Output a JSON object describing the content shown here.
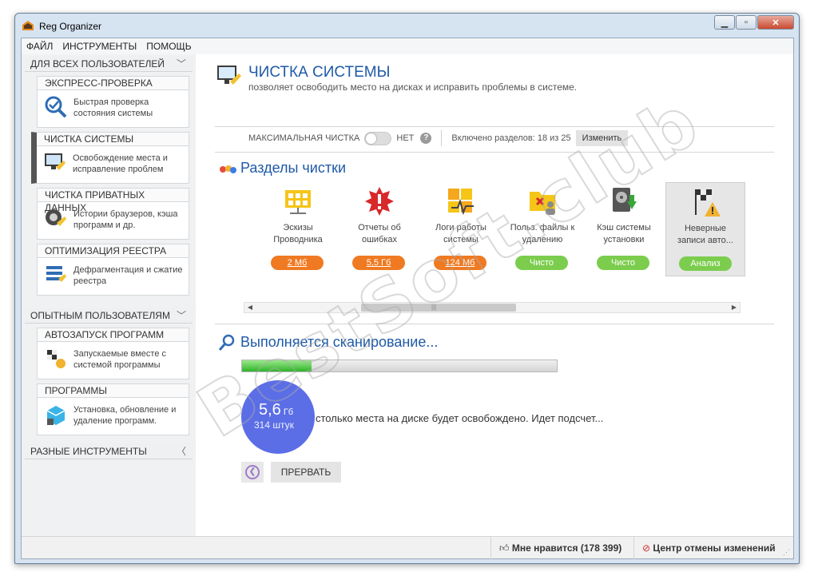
{
  "window": {
    "title": "Reg Organizer"
  },
  "menu": [
    "ФАЙЛ",
    "ИНСТРУМЕНТЫ",
    "ПОМОЩЬ"
  ],
  "sidebar": {
    "cat_all": "ДЛЯ ВСЕХ ПОЛЬЗОВАТЕЛЕЙ",
    "cat_advanced": "ОПЫТНЫМ ПОЛЬЗОВАТЕЛЯМ",
    "cat_misc": "РАЗНЫЕ ИНСТРУМЕНТЫ",
    "tools": [
      {
        "title": "ЭКСПРЕСС-ПРОВЕРКА",
        "desc": "Быстрая проверка состояния системы",
        "icon": "magnifier-check-icon"
      },
      {
        "title": "ЧИСТКА СИСТЕМЫ",
        "desc": "Освобождение места и исправление проблем",
        "icon": "broom-monitor-icon"
      },
      {
        "title": "ЧИСТКА ПРИВАТНЫХ ДАННЫХ",
        "desc": "Истории браузеров, кэша программ и др.",
        "icon": "privacy-clean-icon"
      },
      {
        "title": "ОПТИМИЗАЦИЯ РЕЕСТРА",
        "desc": "Дефрагментация и сжатие реестра",
        "icon": "registry-icon"
      },
      {
        "title": "АВТОЗАПУСК ПРОГРАММ",
        "desc": "Запускаемые вместе с системой программы",
        "icon": "startup-flag-icon"
      },
      {
        "title": "ПРОГРАММЫ",
        "desc": "Установка, обновление и удаление программ.",
        "icon": "programs-box-icon"
      }
    ]
  },
  "main": {
    "title": "ЧИСТКА СИСТЕМЫ",
    "subtitle": "позволяет освободить место на дисках и исправить проблемы в системе.",
    "max_clean_label": "МАКСИМАЛЬНАЯ ЧИСТКА",
    "max_clean_value": "НЕТ",
    "help": "?",
    "sections_enabled": "Включено разделов: 18 из 25",
    "change_button": "Изменить",
    "sections_title": "Разделы чистки",
    "cards": [
      {
        "label": "Эскизы Проводника",
        "badge": "2 Мб",
        "status": "orange",
        "icon": "explorer-thumbnails-icon"
      },
      {
        "label": "Отчеты об ошибках",
        "badge": "5,5 Гб",
        "status": "orange",
        "icon": "error-report-icon"
      },
      {
        "label": "Логи работы системы",
        "badge": "124 Мб",
        "status": "orange",
        "icon": "windows-log-icon"
      },
      {
        "label": "Польз. файлы к удалению",
        "badge": "Чисто",
        "status": "green",
        "icon": "user-files-icon"
      },
      {
        "label": "Кэш системы установки",
        "badge": "Чисто",
        "status": "green",
        "icon": "installer-cache-icon"
      },
      {
        "label": "Неверные записи авто...",
        "badge": "Анализ",
        "status": "green",
        "icon": "startup-warning-icon"
      }
    ],
    "scan_title": "Выполняется сканирование...",
    "progress": 0.22,
    "freed_size": "5,6",
    "freed_unit": "Гб",
    "freed_count": "314 штук",
    "scan_message": "столько места на диске будет освобождено. Идет подсчет...",
    "stop_button": "ПРЕРВАТЬ"
  },
  "status": {
    "likes": "Мне нравится (178 399)",
    "undo_center": "Центр отмены изменений"
  },
  "colors": {
    "accent_blue": "#1f5aa6",
    "badge_orange": "#ef7a22",
    "badge_green": "#7ccd4e",
    "progress_green": "#2fb32a",
    "circle_blue": "#5b6ee6"
  }
}
